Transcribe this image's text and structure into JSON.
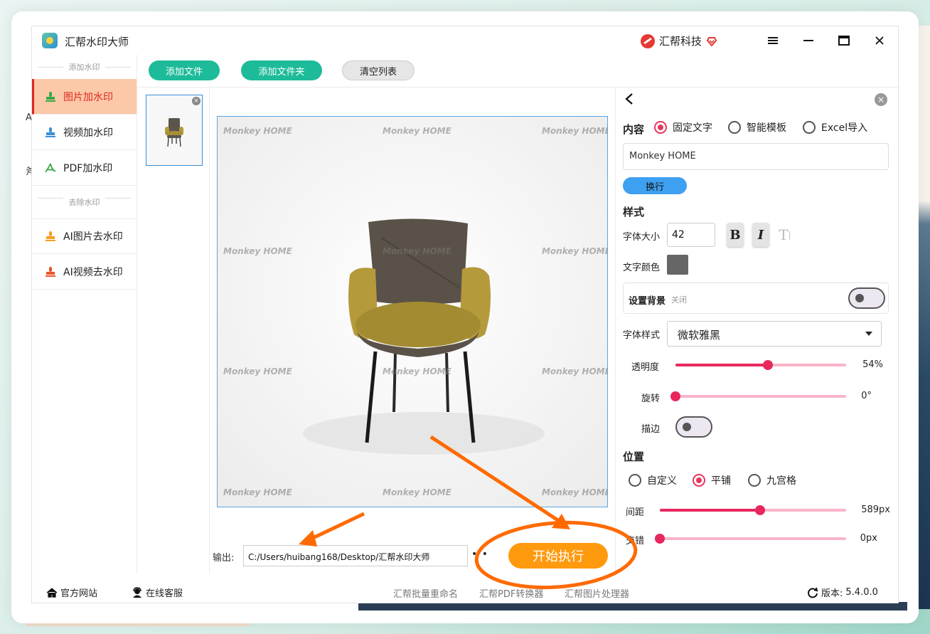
{
  "app": {
    "title": "汇帮水印大师",
    "brand": "汇帮科技"
  },
  "background": {
    "left_text_1": "A",
    "left_text_2": "斧"
  },
  "sidebar": {
    "section_add": "添加水印",
    "section_remove": "去除水印",
    "items": [
      {
        "label": "图片加水印",
        "icon": "image-stamp-icon",
        "active": true
      },
      {
        "label": "视频加水印",
        "icon": "video-stamp-icon",
        "active": false
      },
      {
        "label": "PDF加水印",
        "icon": "pdf-icon",
        "active": false
      },
      {
        "label": "AI图片去水印",
        "icon": "image-stamp-icon",
        "active": false
      },
      {
        "label": "AI视频去水印",
        "icon": "video-stamp-icon",
        "active": false
      }
    ]
  },
  "toolbar": {
    "add_file": "添加文件",
    "add_folder": "添加文件夹",
    "clear_list": "清空列表"
  },
  "preview": {
    "watermark_text": "Monkey HOME"
  },
  "output": {
    "label": "输出:",
    "path": "C:/Users/huibang168/Desktop/汇帮水印大师",
    "browse": "• •"
  },
  "start_button": "开始执行",
  "panel": {
    "content_label": "内容",
    "content_options": [
      "固定文字",
      "智能模板",
      "Excel导入"
    ],
    "content_selected": "固定文字",
    "text_value": "Monkey HOME",
    "newline_button": "换行",
    "style_label": "样式",
    "font_size_label": "字体大小",
    "font_size": "42",
    "bold": "B",
    "italic": "I",
    "clear_format": "T",
    "text_color_label": "文字颜色",
    "text_color": "#666666",
    "background_label": "设置背景",
    "background_state": "关闭",
    "font_style_label": "字体样式",
    "font_style": "微软雅黑",
    "opacity_label": "透明度",
    "opacity_value": "54%",
    "opacity": 0.54,
    "rotate_label": "旋转",
    "rotate_value": "0°",
    "rotate": 0,
    "stroke_label": "描边",
    "position_label": "位置",
    "position_options": [
      "自定义",
      "平铺",
      "九宫格"
    ],
    "position_selected": "平铺",
    "spacing_label": "间距",
    "spacing_value": "589px",
    "spacing": 0.54,
    "stagger_label": "交错",
    "stagger_value": "0px",
    "stagger": 0
  },
  "footer": {
    "website": "官方网站",
    "support": "在线客服",
    "links": [
      "汇帮批量重命名",
      "汇帮PDF转换器",
      "汇帮图片处理器"
    ],
    "version_label": "版本:",
    "version": "5.4.0.0"
  },
  "colors": {
    "accent_green": "#1dbb99",
    "active_red": "#e0281e",
    "slider_pink": "#e8285d",
    "start_orange": "#ff9a0f",
    "annotation_orange": "#ff6a00"
  }
}
